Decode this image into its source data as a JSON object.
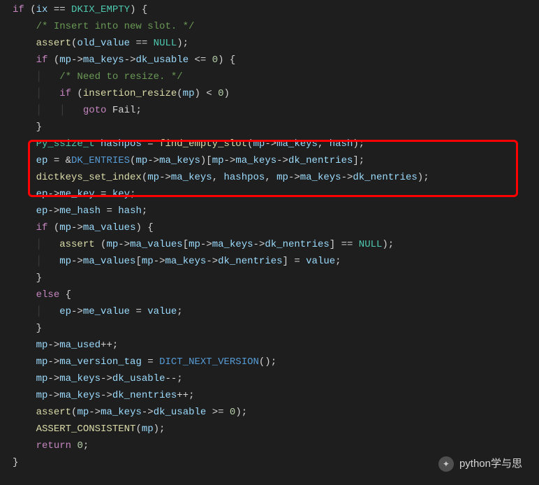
{
  "watermark": {
    "text": "python学与思"
  },
  "code": {
    "lines": [
      [
        {
          "cls": "kw",
          "txt": "if"
        },
        {
          "cls": "op",
          "txt": " ("
        },
        {
          "cls": "id",
          "txt": "ix"
        },
        {
          "cls": "op",
          "txt": " == "
        },
        {
          "cls": "type",
          "txt": "DKIX_EMPTY"
        },
        {
          "cls": "op",
          "txt": ") {"
        }
      ],
      [
        {
          "cls": "op",
          "txt": "    "
        },
        {
          "cls": "cmt",
          "txt": "/* Insert into new slot. */"
        }
      ],
      [
        {
          "cls": "op",
          "txt": "    "
        },
        {
          "cls": "fn",
          "txt": "assert"
        },
        {
          "cls": "op",
          "txt": "("
        },
        {
          "cls": "id",
          "txt": "old_value"
        },
        {
          "cls": "op",
          "txt": " == "
        },
        {
          "cls": "type",
          "txt": "NULL"
        },
        {
          "cls": "op",
          "txt": ");"
        }
      ],
      [
        {
          "cls": "op",
          "txt": "    "
        },
        {
          "cls": "kw",
          "txt": "if"
        },
        {
          "cls": "op",
          "txt": " ("
        },
        {
          "cls": "id",
          "txt": "mp"
        },
        {
          "cls": "op",
          "txt": "->"
        },
        {
          "cls": "id",
          "txt": "ma_keys"
        },
        {
          "cls": "op",
          "txt": "->"
        },
        {
          "cls": "id",
          "txt": "dk_usable"
        },
        {
          "cls": "op",
          "txt": " <= "
        },
        {
          "cls": "num",
          "txt": "0"
        },
        {
          "cls": "op",
          "txt": ") {"
        }
      ],
      [
        {
          "cls": "op",
          "txt": "    "
        },
        {
          "cls": "guide",
          "txt": "│   "
        },
        {
          "cls": "cmt",
          "txt": "/* Need to resize. */"
        }
      ],
      [
        {
          "cls": "op",
          "txt": "    "
        },
        {
          "cls": "guide",
          "txt": "│   "
        },
        {
          "cls": "kw",
          "txt": "if"
        },
        {
          "cls": "op",
          "txt": " ("
        },
        {
          "cls": "fn",
          "txt": "insertion_resize"
        },
        {
          "cls": "op",
          "txt": "("
        },
        {
          "cls": "id",
          "txt": "mp"
        },
        {
          "cls": "op",
          "txt": ") < "
        },
        {
          "cls": "num",
          "txt": "0"
        },
        {
          "cls": "op",
          "txt": ")"
        }
      ],
      [
        {
          "cls": "op",
          "txt": "    "
        },
        {
          "cls": "guide",
          "txt": "│   │   "
        },
        {
          "cls": "kw",
          "txt": "goto"
        },
        {
          "cls": "op",
          "txt": " Fail;"
        }
      ],
      [
        {
          "cls": "op",
          "txt": "    }"
        }
      ],
      [
        {
          "cls": "op",
          "txt": "    "
        },
        {
          "cls": "type",
          "txt": "Py_ssize_t"
        },
        {
          "cls": "op",
          "txt": " "
        },
        {
          "cls": "id",
          "txt": "hashpos"
        },
        {
          "cls": "op",
          "txt": " = "
        },
        {
          "cls": "fn",
          "txt": "find_empty_slot"
        },
        {
          "cls": "op",
          "txt": "("
        },
        {
          "cls": "id",
          "txt": "mp"
        },
        {
          "cls": "op",
          "txt": "->"
        },
        {
          "cls": "id",
          "txt": "ma_keys"
        },
        {
          "cls": "op",
          "txt": ", "
        },
        {
          "cls": "id",
          "txt": "hash"
        },
        {
          "cls": "op",
          "txt": ");"
        }
      ],
      [
        {
          "cls": "op",
          "txt": "    "
        },
        {
          "cls": "id",
          "txt": "ep"
        },
        {
          "cls": "op",
          "txt": " = &"
        },
        {
          "cls": "mac",
          "txt": "DK_ENTRIES"
        },
        {
          "cls": "op",
          "txt": "("
        },
        {
          "cls": "id",
          "txt": "mp"
        },
        {
          "cls": "op",
          "txt": "->"
        },
        {
          "cls": "id",
          "txt": "ma_keys"
        },
        {
          "cls": "op",
          "txt": ")["
        },
        {
          "cls": "id",
          "txt": "mp"
        },
        {
          "cls": "op",
          "txt": "->"
        },
        {
          "cls": "id",
          "txt": "ma_keys"
        },
        {
          "cls": "op",
          "txt": "->"
        },
        {
          "cls": "id",
          "txt": "dk_nentries"
        },
        {
          "cls": "op",
          "txt": "];"
        }
      ],
      [
        {
          "cls": "op",
          "txt": "    "
        },
        {
          "cls": "fn",
          "txt": "dictkeys_set_index"
        },
        {
          "cls": "op",
          "txt": "("
        },
        {
          "cls": "id",
          "txt": "mp"
        },
        {
          "cls": "op",
          "txt": "->"
        },
        {
          "cls": "id",
          "txt": "ma_keys"
        },
        {
          "cls": "op",
          "txt": ", "
        },
        {
          "cls": "id",
          "txt": "hashpos"
        },
        {
          "cls": "op",
          "txt": ", "
        },
        {
          "cls": "id",
          "txt": "mp"
        },
        {
          "cls": "op",
          "txt": "->"
        },
        {
          "cls": "id",
          "txt": "ma_keys"
        },
        {
          "cls": "op",
          "txt": "->"
        },
        {
          "cls": "id",
          "txt": "dk_nentries"
        },
        {
          "cls": "op",
          "txt": ");"
        }
      ],
      [
        {
          "cls": "op",
          "txt": "    "
        },
        {
          "cls": "id",
          "txt": "ep"
        },
        {
          "cls": "op",
          "txt": "->"
        },
        {
          "cls": "id",
          "txt": "me_key"
        },
        {
          "cls": "op",
          "txt": " = "
        },
        {
          "cls": "id",
          "txt": "key"
        },
        {
          "cls": "op",
          "txt": ";"
        }
      ],
      [
        {
          "cls": "op",
          "txt": "    "
        },
        {
          "cls": "id",
          "txt": "ep"
        },
        {
          "cls": "op",
          "txt": "->"
        },
        {
          "cls": "id",
          "txt": "me_hash"
        },
        {
          "cls": "op",
          "txt": " = "
        },
        {
          "cls": "id",
          "txt": "hash"
        },
        {
          "cls": "op",
          "txt": ";"
        }
      ],
      [
        {
          "cls": "op",
          "txt": "    "
        },
        {
          "cls": "kw",
          "txt": "if"
        },
        {
          "cls": "op",
          "txt": " ("
        },
        {
          "cls": "id",
          "txt": "mp"
        },
        {
          "cls": "op",
          "txt": "->"
        },
        {
          "cls": "id",
          "txt": "ma_values"
        },
        {
          "cls": "op",
          "txt": ") {"
        }
      ],
      [
        {
          "cls": "op",
          "txt": "    "
        },
        {
          "cls": "guide",
          "txt": "│   "
        },
        {
          "cls": "fn",
          "txt": "assert"
        },
        {
          "cls": "op",
          "txt": " ("
        },
        {
          "cls": "id",
          "txt": "mp"
        },
        {
          "cls": "op",
          "txt": "->"
        },
        {
          "cls": "id",
          "txt": "ma_values"
        },
        {
          "cls": "op",
          "txt": "["
        },
        {
          "cls": "id",
          "txt": "mp"
        },
        {
          "cls": "op",
          "txt": "->"
        },
        {
          "cls": "id",
          "txt": "ma_keys"
        },
        {
          "cls": "op",
          "txt": "->"
        },
        {
          "cls": "id",
          "txt": "dk_nentries"
        },
        {
          "cls": "op",
          "txt": "] == "
        },
        {
          "cls": "type",
          "txt": "NULL"
        },
        {
          "cls": "op",
          "txt": ");"
        }
      ],
      [
        {
          "cls": "op",
          "txt": "    "
        },
        {
          "cls": "guide",
          "txt": "│   "
        },
        {
          "cls": "id",
          "txt": "mp"
        },
        {
          "cls": "op",
          "txt": "->"
        },
        {
          "cls": "id",
          "txt": "ma_values"
        },
        {
          "cls": "op",
          "txt": "["
        },
        {
          "cls": "id",
          "txt": "mp"
        },
        {
          "cls": "op",
          "txt": "->"
        },
        {
          "cls": "id",
          "txt": "ma_keys"
        },
        {
          "cls": "op",
          "txt": "->"
        },
        {
          "cls": "id",
          "txt": "dk_nentries"
        },
        {
          "cls": "op",
          "txt": "] = "
        },
        {
          "cls": "id",
          "txt": "value"
        },
        {
          "cls": "op",
          "txt": ";"
        }
      ],
      [
        {
          "cls": "op",
          "txt": "    }"
        }
      ],
      [
        {
          "cls": "op",
          "txt": "    "
        },
        {
          "cls": "kw",
          "txt": "else"
        },
        {
          "cls": "op",
          "txt": " {"
        }
      ],
      [
        {
          "cls": "op",
          "txt": "    "
        },
        {
          "cls": "guide",
          "txt": "│   "
        },
        {
          "cls": "id",
          "txt": "ep"
        },
        {
          "cls": "op",
          "txt": "->"
        },
        {
          "cls": "id",
          "txt": "me_value"
        },
        {
          "cls": "op",
          "txt": " = "
        },
        {
          "cls": "id",
          "txt": "value"
        },
        {
          "cls": "op",
          "txt": ";"
        }
      ],
      [
        {
          "cls": "op",
          "txt": "    }"
        }
      ],
      [
        {
          "cls": "op",
          "txt": "    "
        },
        {
          "cls": "id",
          "txt": "mp"
        },
        {
          "cls": "op",
          "txt": "->"
        },
        {
          "cls": "id",
          "txt": "ma_used"
        },
        {
          "cls": "op",
          "txt": "++;"
        }
      ],
      [
        {
          "cls": "op",
          "txt": "    "
        },
        {
          "cls": "id",
          "txt": "mp"
        },
        {
          "cls": "op",
          "txt": "->"
        },
        {
          "cls": "id",
          "txt": "ma_version_tag"
        },
        {
          "cls": "op",
          "txt": " = "
        },
        {
          "cls": "mac",
          "txt": "DICT_NEXT_VERSION"
        },
        {
          "cls": "op",
          "txt": "();"
        }
      ],
      [
        {
          "cls": "op",
          "txt": "    "
        },
        {
          "cls": "id",
          "txt": "mp"
        },
        {
          "cls": "op",
          "txt": "->"
        },
        {
          "cls": "id",
          "txt": "ma_keys"
        },
        {
          "cls": "op",
          "txt": "->"
        },
        {
          "cls": "id",
          "txt": "dk_usable"
        },
        {
          "cls": "op",
          "txt": "--;"
        }
      ],
      [
        {
          "cls": "op",
          "txt": "    "
        },
        {
          "cls": "id",
          "txt": "mp"
        },
        {
          "cls": "op",
          "txt": "->"
        },
        {
          "cls": "id",
          "txt": "ma_keys"
        },
        {
          "cls": "op",
          "txt": "->"
        },
        {
          "cls": "id",
          "txt": "dk_nentries"
        },
        {
          "cls": "op",
          "txt": "++;"
        }
      ],
      [
        {
          "cls": "op",
          "txt": "    "
        },
        {
          "cls": "fn",
          "txt": "assert"
        },
        {
          "cls": "op",
          "txt": "("
        },
        {
          "cls": "id",
          "txt": "mp"
        },
        {
          "cls": "op",
          "txt": "->"
        },
        {
          "cls": "id",
          "txt": "ma_keys"
        },
        {
          "cls": "op",
          "txt": "->"
        },
        {
          "cls": "id",
          "txt": "dk_usable"
        },
        {
          "cls": "op",
          "txt": " >= "
        },
        {
          "cls": "num",
          "txt": "0"
        },
        {
          "cls": "op",
          "txt": ");"
        }
      ],
      [
        {
          "cls": "op",
          "txt": "    "
        },
        {
          "cls": "fn",
          "txt": "ASSERT_CONSISTENT"
        },
        {
          "cls": "op",
          "txt": "("
        },
        {
          "cls": "id",
          "txt": "mp"
        },
        {
          "cls": "op",
          "txt": ");"
        }
      ],
      [
        {
          "cls": "op",
          "txt": "    "
        },
        {
          "cls": "kw",
          "txt": "return"
        },
        {
          "cls": "op",
          "txt": " "
        },
        {
          "cls": "num",
          "txt": "0"
        },
        {
          "cls": "op",
          "txt": ";"
        }
      ],
      [
        {
          "cls": "op",
          "txt": "}"
        }
      ]
    ]
  }
}
